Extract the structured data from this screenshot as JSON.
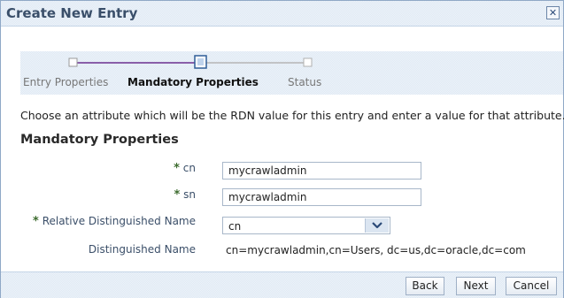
{
  "dialog": {
    "title": "Create New Entry",
    "close_glyph": "✕"
  },
  "train": {
    "steps": [
      {
        "label": "Entry Properties",
        "state": "visited"
      },
      {
        "label": "Mandatory Properties",
        "state": "current"
      },
      {
        "label": "Status",
        "state": "pending"
      }
    ]
  },
  "instructions": "Choose an attribute which will be the RDN value for this entry and enter a value for that attribute.",
  "section_title": "Mandatory Properties",
  "form": {
    "required_marker": "*",
    "cn": {
      "label": "cn",
      "value": "mycrawladmin"
    },
    "sn": {
      "label": "sn",
      "value": "mycrawladmin"
    },
    "rdn": {
      "label": "Relative Distinguished Name",
      "value": "cn"
    },
    "dn": {
      "label": "Distinguished Name",
      "value": "cn=mycrawladmin,cn=Users, dc=us,dc=oracle,dc=com"
    }
  },
  "buttons": {
    "back": "Back",
    "next": "Next",
    "cancel": "Cancel"
  },
  "colors": {
    "train_line_active": "#6b2f8f",
    "train_line_inactive": "#b5b5b5",
    "required_marker": "#3c6b2e"
  }
}
